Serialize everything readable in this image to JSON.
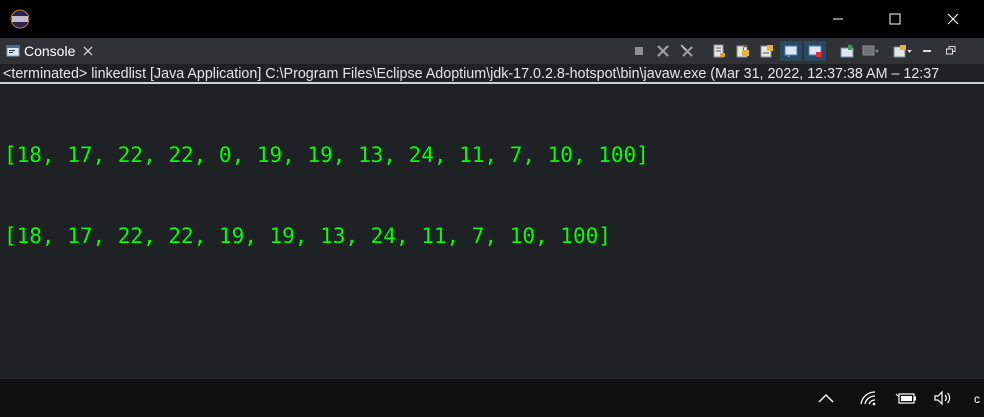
{
  "window": {
    "controls": {
      "minimize_icon": "minimize-icon",
      "maximize_icon": "maximize-icon",
      "close_icon": "close-icon"
    }
  },
  "console_tab": {
    "label": "Console"
  },
  "process_line": "<terminated> linkedlist [Java Application] C:\\Program Files\\Eclipse Adoptium\\jdk-17.0.2.8-hotspot\\bin\\javaw.exe  (Mar 31, 2022, 12:37:38 AM – 12:37",
  "output_lines": [
    "[18, 17, 22, 22, 0, 19, 19, 13, 24, 11, 7, 10, 100]",
    "[18, 17, 22, 22, 19, 19, 13, 24, 11, 7, 10, 100]"
  ],
  "taskbar": {
    "clock_clip": "c"
  },
  "colors": {
    "background": "#1f2224",
    "output_text": "#00ff00",
    "titlebar": "#000000",
    "tabbar": "#2f3336"
  }
}
